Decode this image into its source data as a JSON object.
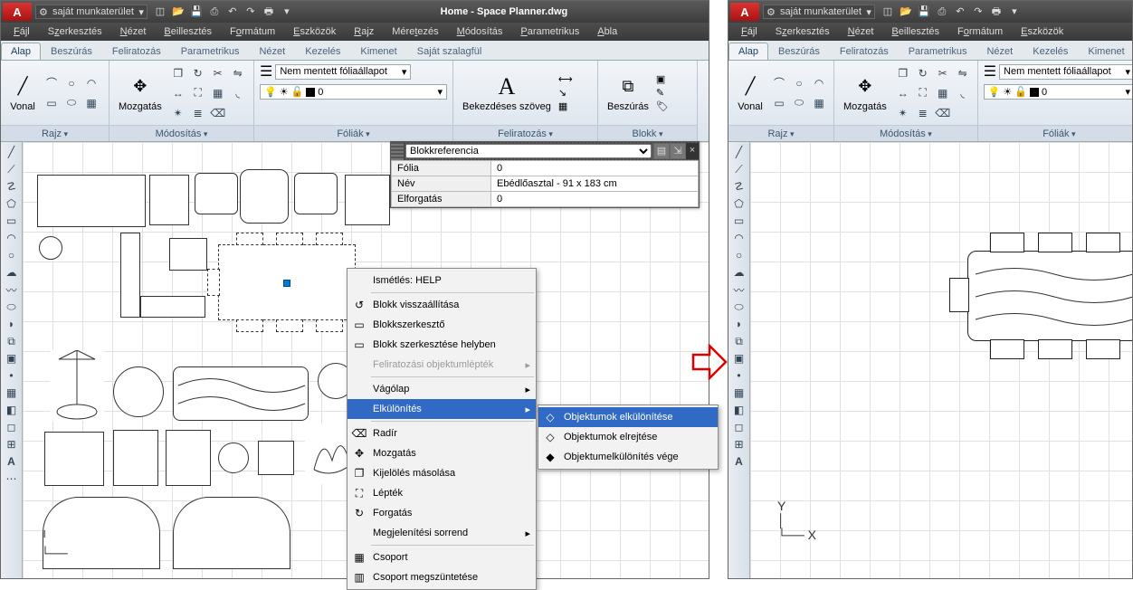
{
  "title": "Home - Space Planner.dwg",
  "workspace": "saját munkaterület",
  "menus": [
    "Fájl",
    "Szerkesztés",
    "Nézet",
    "Beillesztés",
    "Formátum",
    "Eszközök",
    "Rajz",
    "Méretezés",
    "Módosítás",
    "Parametrikus",
    "Abla"
  ],
  "menus_r": [
    "Fájl",
    "Szerkesztés",
    "Nézet",
    "Beillesztés",
    "Formátum",
    "Eszközök"
  ],
  "ribbon_tabs": [
    "Alap",
    "Beszúrás",
    "Feliratozás",
    "Parametrikus",
    "Nézet",
    "Kezelés",
    "Kimenet",
    "Saját szalagfül"
  ],
  "ribbon_tabs_r": [
    "Alap",
    "Beszúrás",
    "Feliratozás",
    "Parametrikus",
    "Nézet",
    "Kezelés",
    "Kimenet"
  ],
  "panels": {
    "draw": "Rajz",
    "modify": "Módosítás",
    "layers": "Fóliák",
    "annotate": "Feliratozás",
    "block": "Blokk",
    "vonal": "Vonal",
    "mozgatas": "Mozgatás",
    "layer_state": "Nem mentett fóliaállapot",
    "layer_current": "0",
    "anno_big": "A",
    "anno_label": "Bekezdéses szöveg",
    "insert_label": "Beszúrás"
  },
  "palette": {
    "type": "Blokkreferencia",
    "rows": [
      {
        "k": "Fólia",
        "v": "0"
      },
      {
        "k": "Név",
        "v": "Ebédlőasztal - 91 x 183 cm"
      },
      {
        "k": "Elforgatás",
        "v": "0"
      }
    ]
  },
  "ctx": {
    "repeat": "Ismétlés: HELP",
    "items1": [
      {
        "t": "Blokk visszaállítása",
        "i": "↺"
      },
      {
        "t": "Blokkszerkesztő",
        "i": "▭"
      },
      {
        "t": "Blokk szerkesztése helyben",
        "i": "▭"
      }
    ],
    "disabled": "Feliratozási objektumlépték",
    "clipboard": "Vágólap",
    "isolate": "Elkülönítés",
    "items2": [
      {
        "t": "Radír",
        "i": "⌫"
      },
      {
        "t": "Mozgatás",
        "i": "✥"
      },
      {
        "t": "Kijelölés másolása",
        "i": "❐"
      },
      {
        "t": "Lépték",
        "i": "⛶"
      },
      {
        "t": "Forgatás",
        "i": "↻"
      },
      {
        "t": "Megjelenítési sorrend",
        "arr": true
      }
    ],
    "items3": [
      {
        "t": "Csoport",
        "i": "▦"
      },
      {
        "t": "Csoport megszüntetése",
        "i": "▥"
      }
    ],
    "sub": [
      {
        "t": "Objektumok elkülönítése",
        "hover": true,
        "i": "◇"
      },
      {
        "t": "Objektumok elrejtése",
        "i": "◇"
      },
      {
        "t": "Objektumelkülönítés vége",
        "i": "◆"
      }
    ]
  }
}
